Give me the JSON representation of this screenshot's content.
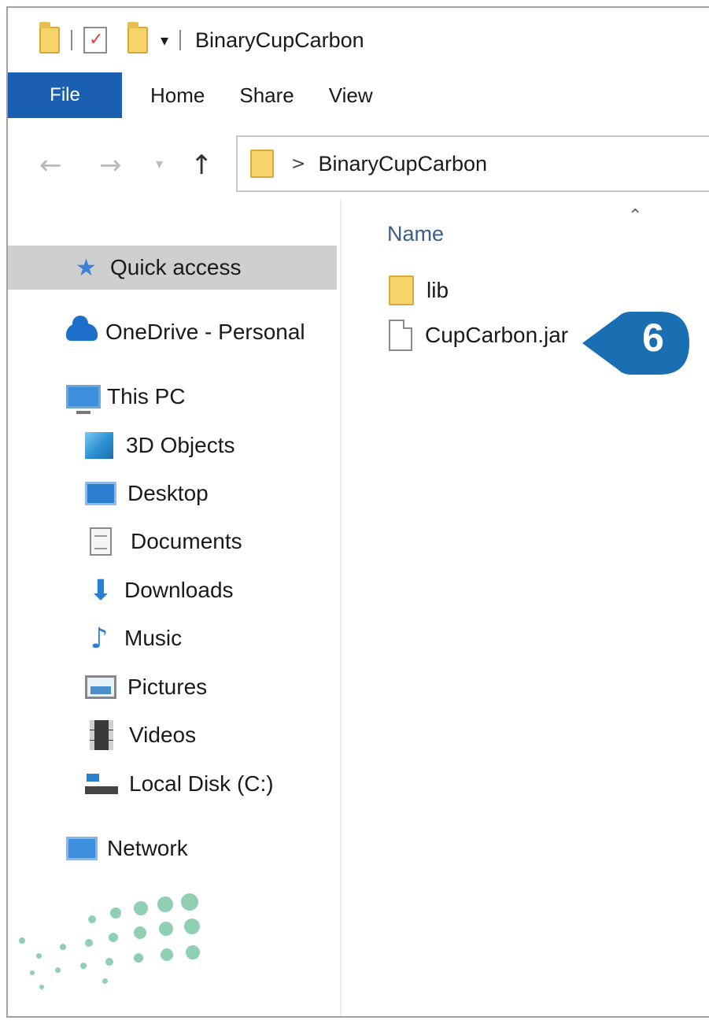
{
  "window": {
    "title": "BinaryCupCarbon"
  },
  "ribbon": {
    "tabs": [
      {
        "label": "File"
      },
      {
        "label": "Home"
      },
      {
        "label": "Share"
      },
      {
        "label": "View"
      }
    ]
  },
  "address_bar": {
    "path": "BinaryCupCarbon",
    "separator": ">"
  },
  "nav_pane": {
    "items": [
      {
        "label": "Quick access",
        "icon": "star-icon",
        "selected": true
      },
      {
        "label": "OneDrive - Personal",
        "icon": "cloud-icon"
      },
      {
        "label": "This PC",
        "icon": "computer-icon"
      },
      {
        "label": "3D Objects",
        "icon": "cube-icon"
      },
      {
        "label": "Desktop",
        "icon": "desktop-icon"
      },
      {
        "label": "Documents",
        "icon": "document-icon"
      },
      {
        "label": "Downloads",
        "icon": "download-icon"
      },
      {
        "label": "Music",
        "icon": "music-icon"
      },
      {
        "label": "Pictures",
        "icon": "pictures-icon"
      },
      {
        "label": "Videos",
        "icon": "video-icon"
      },
      {
        "label": "Local Disk (C:)",
        "icon": "disk-icon"
      },
      {
        "label": "Network",
        "icon": "network-icon"
      }
    ]
  },
  "content": {
    "column_header": "Name",
    "files": [
      {
        "name": "lib",
        "type": "folder"
      },
      {
        "name": "CupCarbon.jar",
        "type": "file"
      }
    ]
  },
  "callout": {
    "step": "6",
    "color": "#1a6fb3"
  },
  "colors": {
    "file_tab": "#1b5fb0",
    "selection": "#cfcfcf",
    "folder": "#f6d36b",
    "decor_dots": "#8fcfb2"
  }
}
